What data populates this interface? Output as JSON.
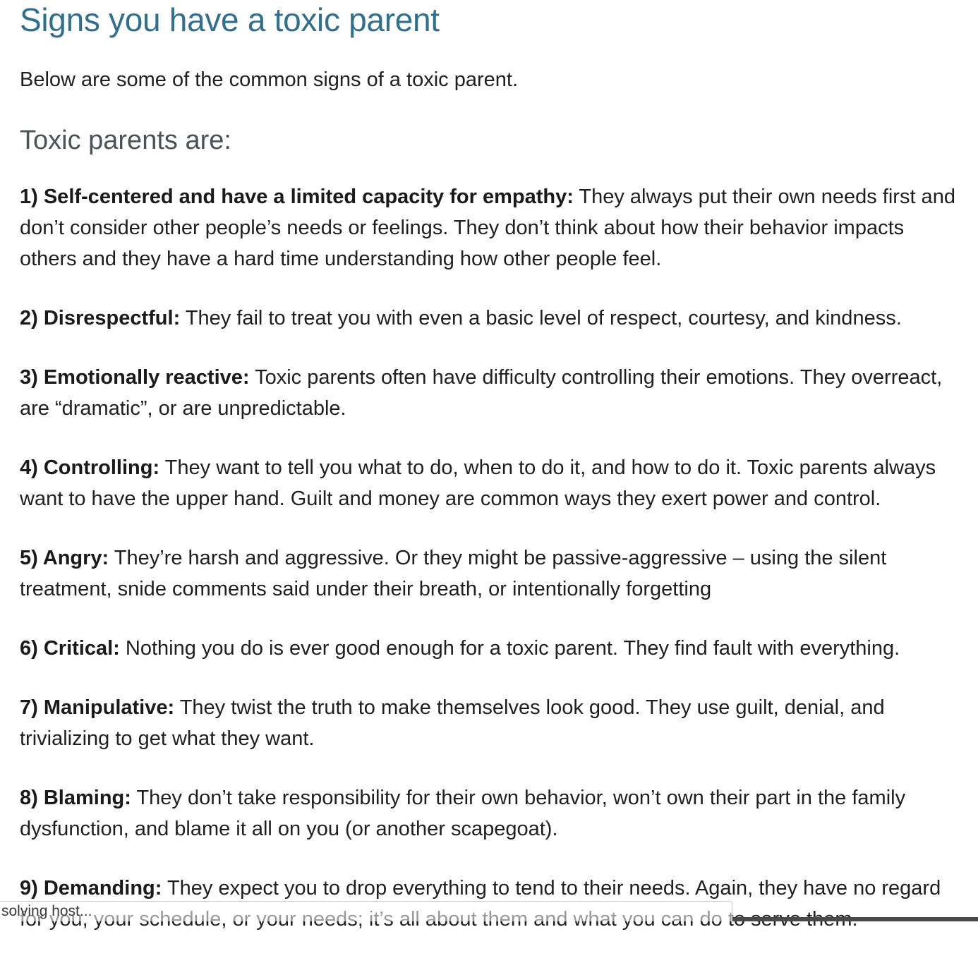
{
  "article": {
    "title": "Signs you have a toxic parent",
    "intro": "Below are some of the common signs of a toxic parent.",
    "subheading": "Toxic parents are:",
    "signs": [
      {
        "label": "1) Self-centered and have a limited capacity for empathy:",
        "text": " They always put their own needs first and don’t consider other people’s needs or feelings. They don’t think about how their behavior impacts others and they have a hard time understanding how other people feel."
      },
      {
        "label": "2) Disrespectful:",
        "text": " They fail to treat you with even a basic level of respect, courtesy, and kindness."
      },
      {
        "label": "3) Emotionally reactive:",
        "text": " Toxic parents often have difficulty controlling their emotions. They overreact, are “dramatic”, or are unpredictable."
      },
      {
        "label": "4) Controlling:",
        "text": " They want to tell you what to do, when to do it, and how to do it. Toxic parents always want to have the upper hand. Guilt and money are common ways they exert power and control."
      },
      {
        "label": "5) Angry:",
        "text": " They’re harsh and aggressive. Or they might be passive-aggressive – using the silent treatment, snide comments said under their breath, or intentionally forgetting"
      },
      {
        "label": "6) Critical:",
        "text": " Nothing you do is ever good enough for a toxic parent. They find fault with everything."
      },
      {
        "label": "7) Manipulative:",
        "text": " They twist the truth to make themselves look good. They use guilt, denial, and trivializing to get what they want."
      },
      {
        "label": "8) Blaming:",
        "text": " They don’t take responsibility for their own behavior, won’t own their part in the family dysfunction, and blame it all on you (or another scapegoat)."
      },
      {
        "label": "9) Demanding:",
        "text": " They expect you to drop everything to tend to their needs. Again, they have no regard for you, your schedule, or your needs; it’s all about them and what you can do to serve them."
      }
    ]
  },
  "browser": {
    "status_text": "solving host..."
  }
}
